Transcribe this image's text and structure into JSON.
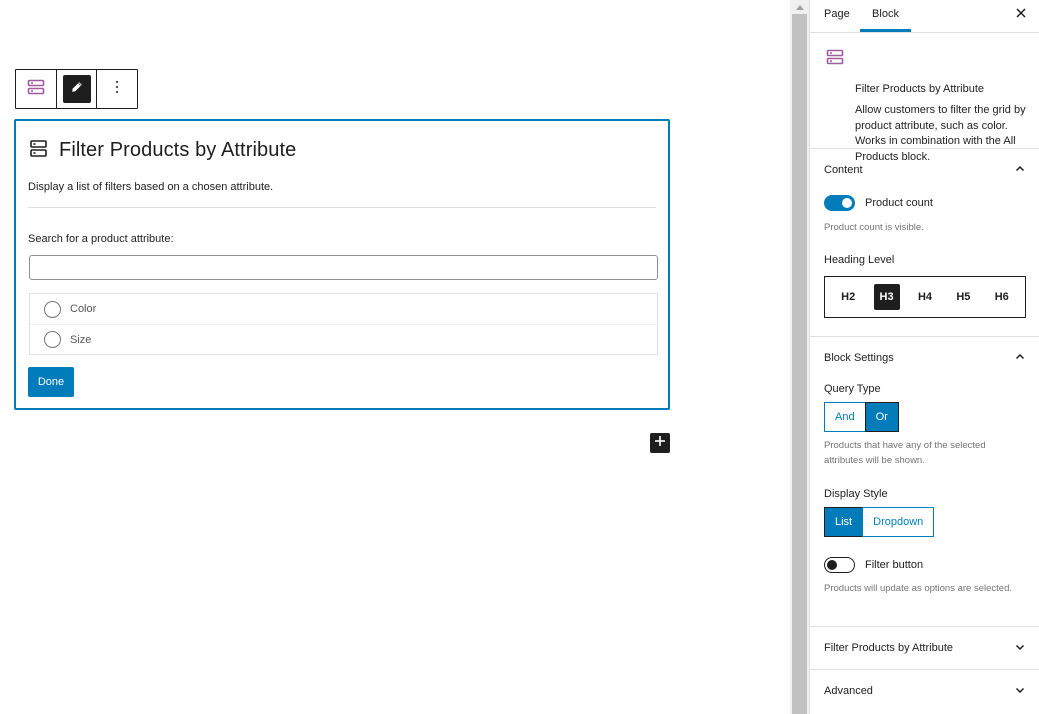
{
  "toolbar": {
    "block_type_icon": "filter-block-icon",
    "edit_icon": "pencil-icon",
    "more_icon": "vertical-ellipsis-icon"
  },
  "block": {
    "title": "Filter Products by Attribute",
    "description": "Display a list of filters based on a chosen attribute.",
    "search_label": "Search for a product attribute:",
    "search_value": "",
    "search_placeholder": "",
    "attributes": [
      {
        "label": "Color",
        "selected": false
      },
      {
        "label": "Size",
        "selected": false
      }
    ],
    "done_label": "Done"
  },
  "inserter": {
    "icon": "plus-icon"
  },
  "sidebar": {
    "tabs": [
      {
        "label": "Page",
        "active": false
      },
      {
        "label": "Block",
        "active": true
      }
    ],
    "close_icon": "close-icon",
    "block_card": {
      "name": "Filter Products by Attribute",
      "description": "Allow customers to filter the grid by product attribute, such as color. Works in combination with the All Products block."
    },
    "content_panel": {
      "title": "Content",
      "expanded": true,
      "product_count_label": "Product count",
      "product_count_on": true,
      "product_count_help": "Product count is visible.",
      "heading_level_label": "Heading Level",
      "heading_levels": [
        "H2",
        "H3",
        "H4",
        "H5",
        "H6"
      ],
      "heading_level_selected": "H3"
    },
    "block_settings_panel": {
      "title": "Block Settings",
      "expanded": true,
      "query_type_label": "Query Type",
      "query_type_options": [
        "And",
        "Or"
      ],
      "query_type_selected": "Or",
      "query_type_help": "Products that have any of the selected attributes will be shown.",
      "display_style_label": "Display Style",
      "display_style_options": [
        "List",
        "Dropdown"
      ],
      "display_style_selected": "List",
      "filter_button_label": "Filter button",
      "filter_button_on": false,
      "filter_button_help": "Products will update as options are selected."
    },
    "collapsed_panels": [
      {
        "title": "Filter Products by Attribute",
        "expanded": false
      },
      {
        "title": "Advanced",
        "expanded": false
      }
    ]
  },
  "colors": {
    "accent": "#007cba",
    "block_icon": "#a05c9e",
    "dark": "#1e1e1e"
  }
}
